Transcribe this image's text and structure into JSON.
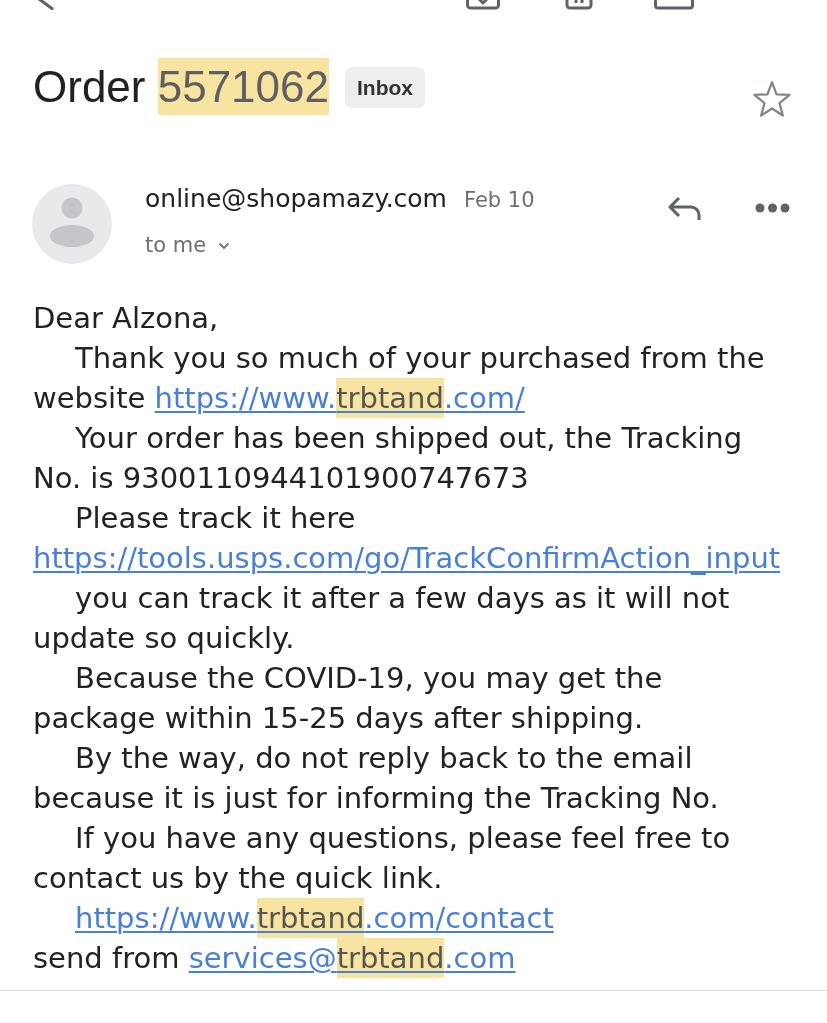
{
  "subject": {
    "parts": [
      {
        "text": "Order ",
        "highlighted": false
      },
      {
        "text": "5571062",
        "highlighted": true
      }
    ],
    "label": "Inbox",
    "starred": false
  },
  "message": {
    "sender": "online@shopamazy.com",
    "date": "Feb 10",
    "recipient": "to me"
  },
  "body": [
    {
      "indent": false,
      "runs": [
        {
          "kind": "text",
          "text": "Dear Alzona,"
        }
      ]
    },
    {
      "indent": true,
      "runs": [
        {
          "kind": "text",
          "text": "Thank you so much of your purchased from the website "
        },
        {
          "kind": "link",
          "parts": [
            {
              "text": "https://www.",
              "highlighted": false
            },
            {
              "text": "trbtand",
              "highlighted": true
            },
            {
              "text": ".com/",
              "highlighted": false
            }
          ]
        }
      ]
    },
    {
      "indent": true,
      "runs": [
        {
          "kind": "text",
          "text": "Your order has been shipped out, the Tracking No. is 9300110944101900747673"
        }
      ]
    },
    {
      "indent": true,
      "runs": [
        {
          "kind": "text",
          "text": "Please track it here "
        },
        {
          "kind": "link",
          "parts": [
            {
              "text": "https://tools.usps.com/go/TrackConfirmAction_input",
              "highlighted": false
            }
          ]
        }
      ]
    },
    {
      "indent": true,
      "runs": [
        {
          "kind": "text",
          "text": "you can track it after a few days as it will not update so quickly."
        }
      ]
    },
    {
      "indent": true,
      "runs": [
        {
          "kind": "text",
          "text": "Because the COVID-19, you may get the package within 15-25 days after shipping."
        }
      ]
    },
    {
      "indent": true,
      "runs": [
        {
          "kind": "text",
          "text": "By the way, do not reply back to the email because it is just for informing the Tracking No."
        }
      ]
    },
    {
      "indent": true,
      "runs": [
        {
          "kind": "text",
          "text": "If you have any questions, please feel free to contact us by the quick link."
        }
      ]
    },
    {
      "indent": true,
      "runs": [
        {
          "kind": "link",
          "parts": [
            {
              "text": "https://www.",
              "highlighted": false
            },
            {
              "text": "trbtand",
              "highlighted": true
            },
            {
              "text": ".com/contact",
              "highlighted": false
            }
          ]
        }
      ]
    },
    {
      "indent": false,
      "runs": [
        {
          "kind": "text",
          "text": "send from "
        },
        {
          "kind": "link",
          "parts": [
            {
              "text": "services@",
              "highlighted": false
            },
            {
              "text": "trbtand",
              "highlighted": true
            },
            {
              "text": ".com",
              "highlighted": false
            }
          ]
        }
      ]
    }
  ]
}
